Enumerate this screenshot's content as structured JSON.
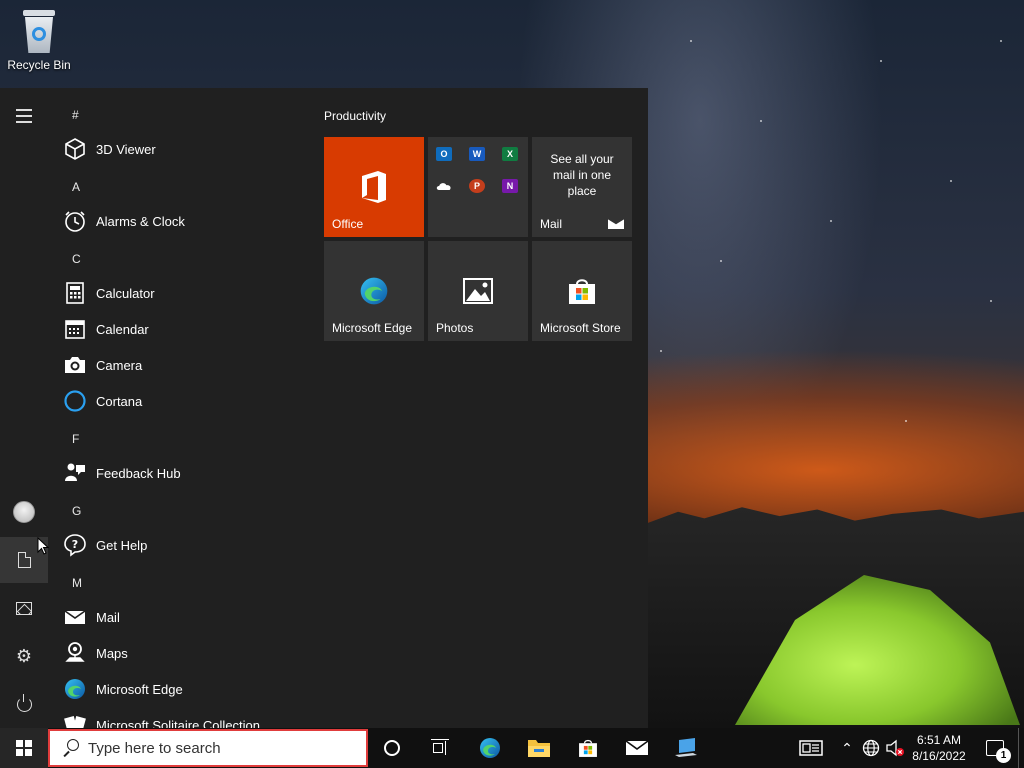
{
  "desktop": {
    "recycle_bin_label": "Recycle Bin"
  },
  "start_menu": {
    "rail": {
      "menu_icon": "hamburger-icon",
      "user_icon": "avatar",
      "documents_icon": "document-icon",
      "pictures_icon": "pictures-icon",
      "settings_icon": "gear-icon",
      "power_icon": "power-icon"
    },
    "app_list": [
      {
        "type": "header",
        "label": "#"
      },
      {
        "type": "app",
        "label": "3D Viewer",
        "icon": "cube-icon"
      },
      {
        "type": "header",
        "label": "A"
      },
      {
        "type": "app",
        "label": "Alarms & Clock",
        "icon": "clock-icon"
      },
      {
        "type": "header",
        "label": "C"
      },
      {
        "type": "app",
        "label": "Calculator",
        "icon": "calculator-icon"
      },
      {
        "type": "app",
        "label": "Calendar",
        "icon": "calendar-icon"
      },
      {
        "type": "app",
        "label": "Camera",
        "icon": "camera-icon"
      },
      {
        "type": "app",
        "label": "Cortana",
        "icon": "cortana-icon"
      },
      {
        "type": "header",
        "label": "F"
      },
      {
        "type": "app",
        "label": "Feedback Hub",
        "icon": "feedback-icon"
      },
      {
        "type": "header",
        "label": "G"
      },
      {
        "type": "app",
        "label": "Get Help",
        "icon": "help-icon"
      },
      {
        "type": "header",
        "label": "M"
      },
      {
        "type": "app",
        "label": "Mail",
        "icon": "mail-icon"
      },
      {
        "type": "app",
        "label": "Maps",
        "icon": "maps-icon"
      },
      {
        "type": "app",
        "label": "Microsoft Edge",
        "icon": "edge-icon"
      },
      {
        "type": "app",
        "label": "Microsoft Solitaire Collection",
        "icon": "cards-icon"
      }
    ],
    "tile_group_title": "Productivity",
    "tiles": {
      "office": {
        "label": "Office",
        "color": "#d83b01"
      },
      "office_apps": {
        "apps": [
          "O",
          "W",
          "X",
          "",
          "P",
          "N"
        ]
      },
      "mail": {
        "label": "Mail",
        "text": "See all your mail in one place"
      },
      "edge": {
        "label": "Microsoft Edge"
      },
      "photos": {
        "label": "Photos"
      },
      "store": {
        "label": "Microsoft Store"
      }
    }
  },
  "taskbar": {
    "search_placeholder": "Type here to search",
    "search_highlight_color": "#e03c3c",
    "clock_time": "6:51 AM",
    "clock_date": "8/16/2022",
    "notification_count": "1"
  }
}
